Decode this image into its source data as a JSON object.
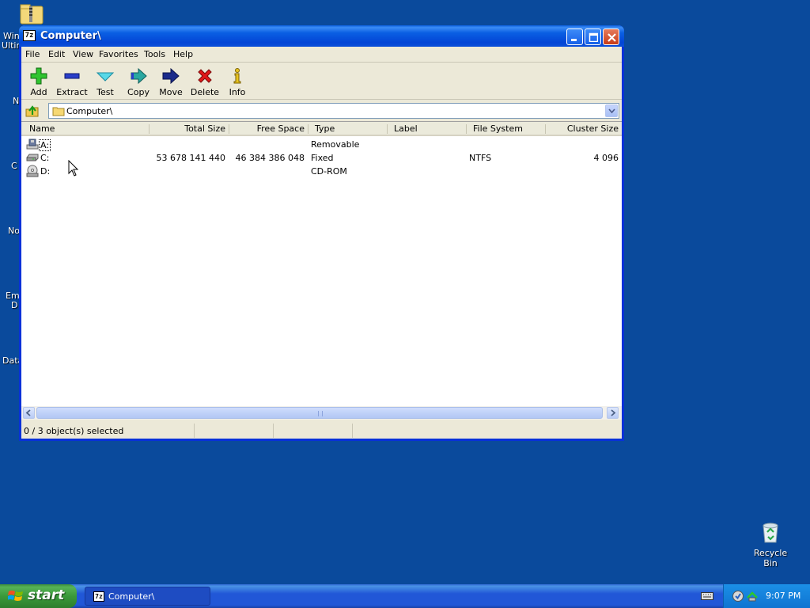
{
  "desktop": {
    "fragments": [
      "Win",
      "Ultin",
      "N",
      "C",
      "No",
      "Em",
      "D",
      "Data"
    ],
    "recycle_bin_label": "Recycle Bin"
  },
  "window": {
    "title": "Computer\\",
    "title_icon_text": "7z"
  },
  "menu": [
    "File",
    "Edit",
    "View",
    "Favorites",
    "Tools",
    "Help"
  ],
  "toolbar": {
    "add": "Add",
    "extract": "Extract",
    "test": "Test",
    "copy": "Copy",
    "move": "Move",
    "delete": "Delete",
    "info": "Info"
  },
  "address": {
    "value": "Computer\\"
  },
  "columns": [
    "Name",
    "Total Size",
    "Free Space",
    "Type",
    "Label",
    "File System",
    "Cluster Size"
  ],
  "rows": [
    {
      "name": "A:",
      "total": "",
      "free": "",
      "type": "Removable",
      "label": "",
      "fs": "",
      "cluster": ""
    },
    {
      "name": "C:",
      "total": "53 678 141 440",
      "free": "46 384 386 048",
      "type": "Fixed",
      "label": "",
      "fs": "NTFS",
      "cluster": "4 096"
    },
    {
      "name": "D:",
      "total": "",
      "free": "",
      "type": "CD-ROM",
      "label": "",
      "fs": "",
      "cluster": ""
    }
  ],
  "status": {
    "selection": "0 / 3 object(s) selected"
  },
  "taskbar": {
    "start_label": "start",
    "task_title": "Computer\\",
    "task_icon_text": "7z",
    "clock": "9:07 PM"
  },
  "colors": {
    "desktop": "#0a4a9c",
    "titlebar": "#0a5fe3",
    "taskbar": "#2157d7",
    "start": "#3a993a"
  }
}
